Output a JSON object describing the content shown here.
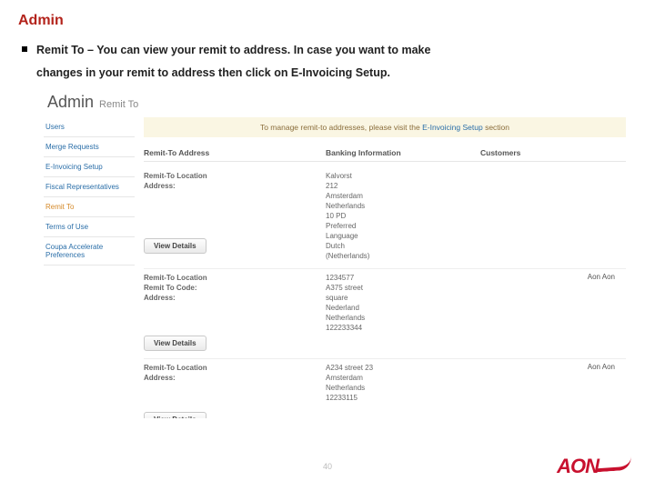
{
  "slide": {
    "title": "Admin",
    "bullet_strong_lead": "Remit To – ",
    "bullet_rest": "You can view your remit to address. In case you want to make",
    "bullet_cont": "changes in your remit to address then click on E-Invoicing Setup.",
    "page_number": "40",
    "logo_text": "AON"
  },
  "shot": {
    "heading_main": "Admin",
    "heading_sub": "Remit To",
    "notice_pre": "To manage remit-to addresses, please visit the ",
    "notice_link": "E-Invoicing Setup",
    "notice_post": " section",
    "sidebar": [
      "Users",
      "Merge Requests",
      "E-Invoicing Setup",
      "Fiscal Representatives",
      "Remit To",
      "Terms of Use",
      "Coupa Accelerate Preferences"
    ],
    "sidebar_active_index": 4,
    "columns": [
      "Remit-To Address",
      "Banking Information",
      "Customers"
    ],
    "view_details_label": "View Details",
    "records": [
      {
        "left_labels": [
          "Remit-To Location",
          "Address:"
        ],
        "mid_values": [
          "Kalvorst",
          "212",
          "Amsterdam",
          "Netherlands",
          "10   PD",
          "Preferred",
          "Language",
          "Dutch",
          "(Netherlands)"
        ],
        "customer": ""
      },
      {
        "left_labels": [
          "Remit-To Location",
          "Remit To Code:",
          "Address:"
        ],
        "mid_values": [
          "1234577",
          "A375 street",
          "square",
          "Nederland",
          "Netherlands",
          "122233344"
        ],
        "customer": "Aon Aon"
      },
      {
        "left_labels": [
          "Remit-To Location",
          "Address:"
        ],
        "mid_values": [
          "A234 street 23",
          "Amsterdam",
          "Netherlands",
          "12233115"
        ],
        "customer": "Aon Aon"
      }
    ]
  }
}
